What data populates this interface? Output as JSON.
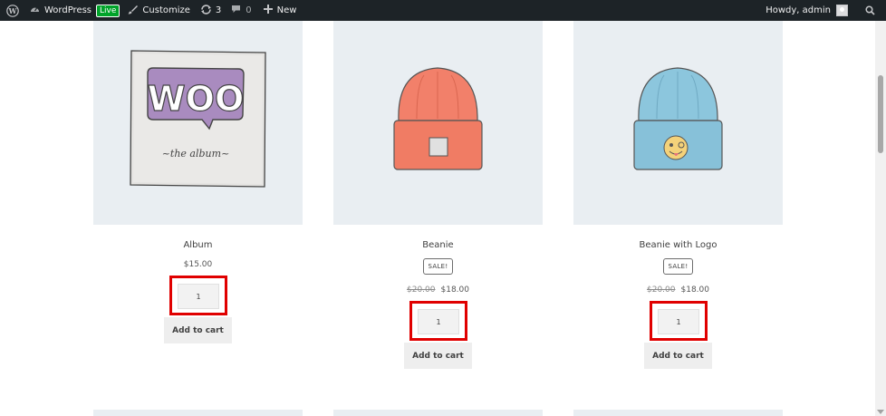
{
  "admin_bar": {
    "site_name": "WordPress",
    "live_badge": "Live",
    "customize": "Customize",
    "updates_count": "3",
    "comments_count": "0",
    "new_label": "New",
    "howdy": "Howdy, admin"
  },
  "products": [
    {
      "name": "Album",
      "price": "$15.00",
      "quantity": "1",
      "add_to_cart": "Add to cart",
      "image_text_big": "WOO",
      "image_text_small": "~the  album~"
    },
    {
      "name": "Beanie",
      "sale_badge": "SALE!",
      "old_price": "$20.00",
      "price": "$18.00",
      "quantity": "1",
      "add_to_cart": "Add to cart"
    },
    {
      "name": "Beanie with Logo",
      "sale_badge": "SALE!",
      "old_price": "$20.00",
      "price": "$18.00",
      "quantity": "1",
      "add_to_cart": "Add to cart"
    }
  ],
  "colors": {
    "admin_bar_bg": "#1d2327",
    "live_badge_bg": "#00a32a",
    "product_image_bg": "#e9eef2",
    "highlight_border": "#e00000",
    "beanie_orange": "#f2806a",
    "beanie_blue": "#8cc6dd"
  }
}
